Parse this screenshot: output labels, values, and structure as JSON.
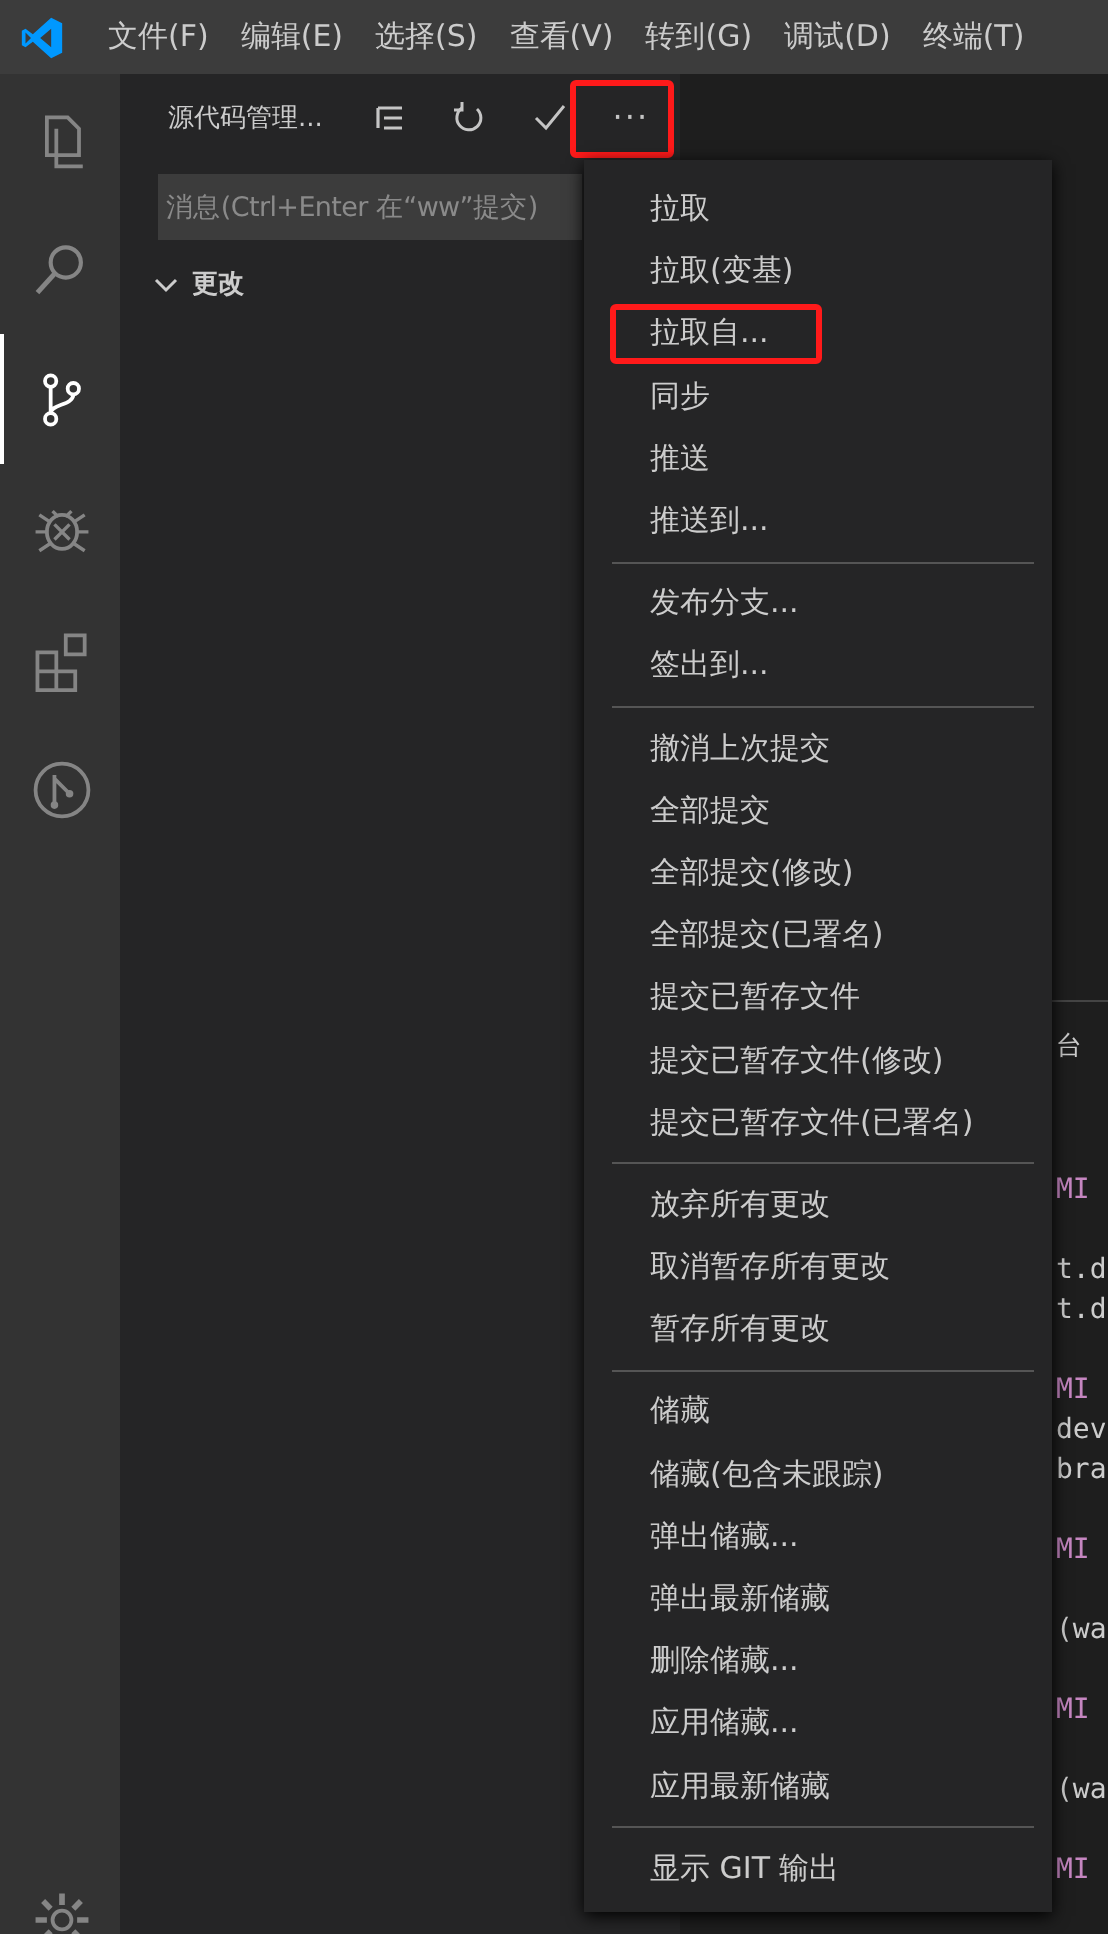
{
  "title_bar": {
    "menus": [
      {
        "label": "文件(F)"
      },
      {
        "label": "编辑(E)"
      },
      {
        "label": "选择(S)"
      },
      {
        "label": "查看(V)"
      },
      {
        "label": "转到(G)"
      },
      {
        "label": "调试(D)"
      },
      {
        "label": "终端(T)"
      }
    ]
  },
  "activity_bar": {
    "items": [
      {
        "kind": "files",
        "selected": false
      },
      {
        "kind": "search",
        "selected": false
      },
      {
        "kind": "source-control",
        "selected": true
      },
      {
        "kind": "debug",
        "selected": false
      },
      {
        "kind": "extensions",
        "selected": false
      },
      {
        "kind": "git-graph",
        "selected": false
      }
    ],
    "bottom": [
      {
        "kind": "settings",
        "selected": false
      }
    ]
  },
  "sidebar": {
    "title": "源代码管理...",
    "actions": [
      {
        "kind": "tree",
        "highlighted": false
      },
      {
        "kind": "refresh",
        "highlighted": false
      },
      {
        "kind": "commit",
        "highlighted": false
      },
      {
        "kind": "more",
        "label": "···",
        "highlighted": true
      }
    ],
    "message_field": {
      "placeholder": "消息(Ctrl+Enter 在“ww”提交)"
    },
    "section": {
      "label": "更改",
      "expanded": true
    }
  },
  "panel": {
    "tab": "台",
    "lines": [
      {
        "kind": "blank"
      },
      {
        "kind": "blank"
      },
      {
        "kind": "keyword",
        "text": "MI"
      },
      {
        "kind": "blank"
      },
      {
        "kind": "plain",
        "text": "t.d"
      },
      {
        "kind": "plain",
        "text": "t.d"
      },
      {
        "kind": "blank"
      },
      {
        "kind": "keyword",
        "text": "MI"
      },
      {
        "kind": "plain",
        "text": "dev"
      },
      {
        "kind": "plain",
        "text": "bra"
      },
      {
        "kind": "blank"
      },
      {
        "kind": "keyword",
        "text": "MI"
      },
      {
        "kind": "blank"
      },
      {
        "kind": "plain",
        "text": "(wa"
      },
      {
        "kind": "blank"
      },
      {
        "kind": "keyword",
        "text": "MI"
      },
      {
        "kind": "blank"
      },
      {
        "kind": "plain",
        "text": "(wa"
      },
      {
        "kind": "blank"
      },
      {
        "kind": "keyword",
        "text": "MI"
      }
    ]
  },
  "context_menu": {
    "items": [
      {
        "kind": "item",
        "label": "拉取",
        "highlighted": false
      },
      {
        "kind": "item",
        "label": "拉取(变基)",
        "highlighted": false
      },
      {
        "kind": "item",
        "label": "拉取自...",
        "highlighted": true
      },
      {
        "kind": "item",
        "label": "同步",
        "highlighted": false
      },
      {
        "kind": "item",
        "label": "推送",
        "highlighted": false
      },
      {
        "kind": "item",
        "label": "推送到...",
        "highlighted": false
      },
      {
        "kind": "separator"
      },
      {
        "kind": "item",
        "label": "发布分支...",
        "highlighted": false
      },
      {
        "kind": "item",
        "label": "签出到...",
        "highlighted": false
      },
      {
        "kind": "separator"
      },
      {
        "kind": "item",
        "label": "撤消上次提交",
        "highlighted": false
      },
      {
        "kind": "item",
        "label": "全部提交",
        "highlighted": false
      },
      {
        "kind": "item",
        "label": "全部提交(修改)",
        "highlighted": false
      },
      {
        "kind": "item",
        "label": "全部提交(已署名)",
        "highlighted": false
      },
      {
        "kind": "item",
        "label": "提交已暂存文件",
        "highlighted": false
      },
      {
        "kind": "item",
        "label": "提交已暂存文件(修改)",
        "highlighted": false
      },
      {
        "kind": "item",
        "label": "提交已暂存文件(已署名)",
        "highlighted": false
      },
      {
        "kind": "separator"
      },
      {
        "kind": "item",
        "label": "放弃所有更改",
        "highlighted": false
      },
      {
        "kind": "item",
        "label": "取消暂存所有更改",
        "highlighted": false
      },
      {
        "kind": "item",
        "label": "暂存所有更改",
        "highlighted": false
      },
      {
        "kind": "separator"
      },
      {
        "kind": "item",
        "label": "储藏",
        "highlighted": false
      },
      {
        "kind": "item",
        "label": "储藏(包含未跟踪)",
        "highlighted": false
      },
      {
        "kind": "item",
        "label": "弹出储藏...",
        "highlighted": false
      },
      {
        "kind": "item",
        "label": "弹出最新储藏",
        "highlighted": false
      },
      {
        "kind": "item",
        "label": "删除储藏...",
        "highlighted": false
      },
      {
        "kind": "item",
        "label": "应用储藏...",
        "highlighted": false
      },
      {
        "kind": "item",
        "label": "应用最新储藏",
        "highlighted": false
      },
      {
        "kind": "separator"
      },
      {
        "kind": "item",
        "label": "显示 GIT 输出",
        "highlighted": false
      }
    ]
  }
}
